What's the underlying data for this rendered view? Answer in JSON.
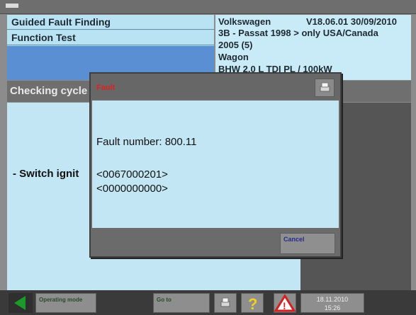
{
  "window": {
    "title": ""
  },
  "header": {
    "left_rows": [
      "Guided Fault Finding",
      "Function Test"
    ],
    "vehicle_make": "Volkswagen",
    "version": "V18.06.01 30/09/2010",
    "vehicle_lines": [
      "3B - Passat 1998 > only USA/Canada",
      "2005 (5)",
      "Wagon",
      "BHW 2.0 L TDI PL / 100kW"
    ]
  },
  "section": {
    "title": "Checking cycle"
  },
  "main": {
    "instruction": "- Switch ignit"
  },
  "dialog": {
    "title": "Fault",
    "fault_number": "Fault number: 800.11",
    "codes": [
      "<0067000201>",
      "<0000000000>"
    ],
    "cancel_label": "Cancel"
  },
  "toolbar": {
    "operating_mode_label": "Operating mode",
    "goto_label": "Go to",
    "date": "18.11.2010",
    "time": "15:26"
  },
  "icons": {
    "back": "arrow-left-icon",
    "close": "printer-icon",
    "tool": "printer-icon",
    "help": "question-icon",
    "warning": "warning-icon"
  },
  "colors": {
    "accent_blue": "#a8daf0",
    "panel_blue": "#5b8fd4",
    "warning_red": "#d42020",
    "help_yellow": "#f0d020",
    "back_green": "#1a9a2a"
  }
}
